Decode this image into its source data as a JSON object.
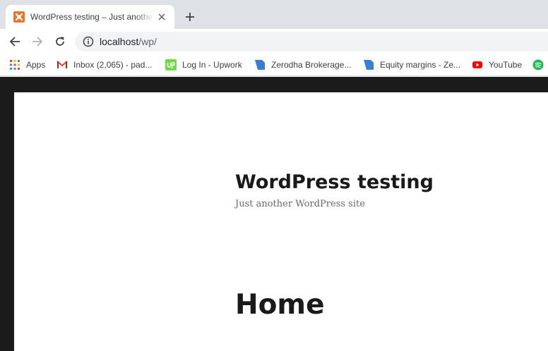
{
  "tab": {
    "title": "WordPress testing – Just another WordPress site",
    "favicon": "xampp-icon"
  },
  "toolbar": {
    "url_host": "localhost",
    "url_path": "/wp/"
  },
  "bookmarks": [
    {
      "label": "Apps",
      "icon": "apps-grid-icon"
    },
    {
      "label": "Inbox (2,065) - pad...",
      "icon": "gmail-icon"
    },
    {
      "label": "Log In - Upwork",
      "icon": "upwork-icon"
    },
    {
      "label": "Zerodha Brokerage...",
      "icon": "zerodha-icon"
    },
    {
      "label": "Equity margins - Ze...",
      "icon": "zerodha-icon"
    },
    {
      "label": "YouTube",
      "icon": "youtube-icon"
    },
    {
      "label": "",
      "icon": "spotify-icon"
    }
  ],
  "page": {
    "site_title": "WordPress testing",
    "site_description": "Just another WordPress site",
    "entry_title": "Home"
  },
  "colors": {
    "tabstrip": "#dee1e6",
    "omnibox": "#f1f3f4",
    "page_frame": "#1b1b1b",
    "text_dark": "#1a1a1a",
    "text_muted": "#686868"
  }
}
